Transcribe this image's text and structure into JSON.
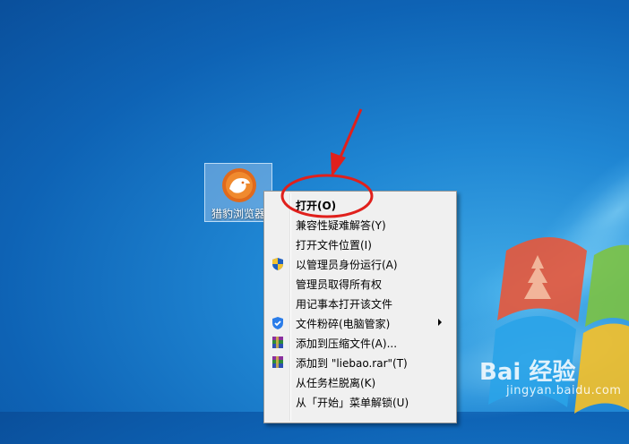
{
  "desktop_icon": {
    "label": "猎豹浏览器",
    "icon": "cheetah-browser-icon"
  },
  "menu": {
    "items": [
      {
        "label": "打开(O)",
        "bold": true,
        "icon": ""
      },
      {
        "label": "兼容性疑难解答(Y)",
        "icon": ""
      },
      {
        "label": "打开文件位置(I)",
        "icon": ""
      },
      {
        "label": "以管理员身份运行(A)",
        "icon": "uac-shield-icon"
      },
      {
        "label": "管理员取得所有权",
        "icon": ""
      },
      {
        "label": "用记事本打开该文件",
        "icon": ""
      },
      {
        "label": "文件粉碎(电脑管家)",
        "icon": "shield-check-icon",
        "submenu": true
      },
      {
        "label": "添加到压缩文件(A)...",
        "icon": "winrar-icon"
      },
      {
        "label": "添加到 \"liebao.rar\"(T)",
        "icon": "winrar-icon"
      },
      {
        "label": "从任务栏脱离(K)",
        "icon": ""
      },
      {
        "label": "从「开始」菜单解锁(U)",
        "icon": ""
      }
    ]
  },
  "watermark": {
    "brand": "Bai 经验",
    "url": "jingyan.baidu.com"
  },
  "colors": {
    "annotation_red": "#e0201c",
    "desktop_blue": "#1f86d3"
  }
}
